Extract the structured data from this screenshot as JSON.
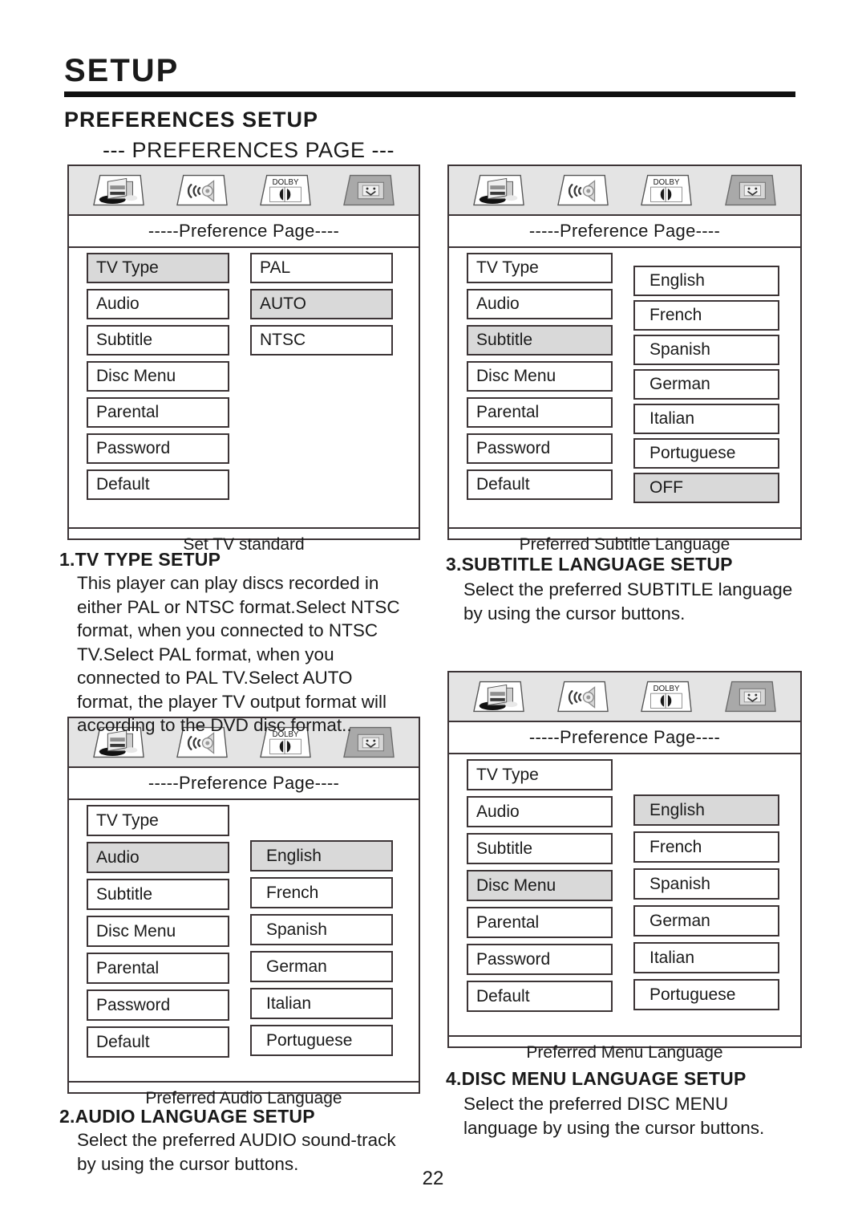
{
  "header": {
    "title": "SETUP",
    "subtitle": "PREFERENCES SETUP",
    "page_label": "--- PREFERENCES PAGE ---"
  },
  "icons": {
    "general": "general-setup-icon",
    "audio": "audio-speaker-icon",
    "dolby": "dolby-digital-icon",
    "preference": "preference-icon",
    "dolby_text": "DOLBY"
  },
  "osd_title": "-----Preference Page----",
  "menu_items": [
    "TV Type",
    "Audio",
    "Subtitle",
    "Disc Menu",
    "Parental",
    "Password",
    "Default"
  ],
  "panels": [
    {
      "id": "tv-type",
      "title": "-----Preference Page----",
      "left_items": [
        "TV Type",
        "Audio",
        "Subtitle",
        "Disc Menu",
        "Parental",
        "Password",
        "Default"
      ],
      "left_selected": "TV Type",
      "right_items": [
        "PAL",
        "AUTO",
        "NTSC"
      ],
      "right_selected": "AUTO",
      "footer": "Set TV standard"
    },
    {
      "id": "subtitle-language",
      "title": "-----Preference Page----",
      "left_items": [
        "TV Type",
        "Audio",
        "Subtitle",
        "Disc Menu",
        "Parental",
        "Password",
        "Default"
      ],
      "left_selected": "Subtitle",
      "right_items": [
        "English",
        "French",
        "Spanish",
        "German",
        "Italian",
        "Portuguese",
        "OFF"
      ],
      "right_selected": "OFF",
      "footer": "Preferred Subtitle Language"
    },
    {
      "id": "audio-language",
      "title": "-----Preference Page----",
      "left_items": [
        "TV Type",
        "Audio",
        "Subtitle",
        "Disc Menu",
        "Parental",
        "Password",
        "Default"
      ],
      "left_selected": "Audio",
      "right_items": [
        "English",
        "French",
        "Spanish",
        "German",
        "Italian",
        "Portuguese"
      ],
      "right_selected": "English",
      "footer": "Preferred Audio Language"
    },
    {
      "id": "disc-menu-language",
      "title": "-----Preference Page----",
      "left_items": [
        "TV Type",
        "Audio",
        "Subtitle",
        "Disc Menu",
        "Parental",
        "Password",
        "Default"
      ],
      "left_selected": "Disc Menu",
      "right_items": [
        "English",
        "French",
        "Spanish",
        "German",
        "Italian",
        "Portuguese"
      ],
      "right_selected": "English",
      "footer": "Preferred Menu Language"
    }
  ],
  "sections": {
    "s1": {
      "heading": "1.TV TYPE SETUP",
      "body": "This player can play discs recorded in either PAL or NTSC format.Select NTSC format, when you connected to NTSC TV.Select PAL format, when you connected to PAL TV.Select AUTO format, the player TV output format will according to the DVD disc format.."
    },
    "s2": {
      "heading": "2.AUDIO LANGUAGE SETUP",
      "body": "Select the preferred AUDIO sound-track by using the cursor buttons."
    },
    "s3": {
      "heading": "3.SUBTITLE LANGUAGE SETUP",
      "body": "Select the preferred SUBTITLE language by using the cursor buttons."
    },
    "s4": {
      "heading": "4.DISC MENU LANGUAGE SETUP",
      "body": "Select the preferred DISC MENU language by using the cursor buttons."
    }
  },
  "page_number": "22",
  "colors": {
    "ink": "#1a1a1a",
    "border": "#3c3436",
    "highlight": "#d9d9d9",
    "iconbar": "#e4e4e4"
  }
}
